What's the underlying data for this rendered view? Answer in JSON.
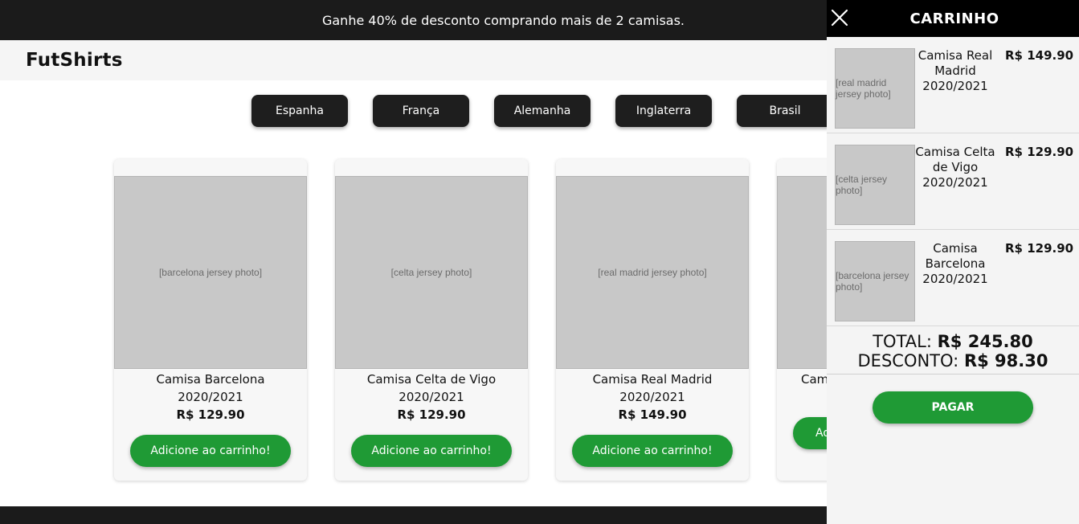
{
  "promo": {
    "text": "Ganhe 40% de desconto comprando mais de 2 camisas."
  },
  "header": {
    "brand": "FutShirts"
  },
  "filters": [
    {
      "label": "Espanha"
    },
    {
      "label": "França"
    },
    {
      "label": "Alemanha"
    },
    {
      "label": "Inglaterra"
    },
    {
      "label": "Brasil"
    }
  ],
  "products": [
    {
      "name": "Camisa Barcelona 2020/2021",
      "price": "R$ 129.90",
      "button": "Adicione ao carrinho!",
      "image": "barcelona-jersey-photo"
    },
    {
      "name": "Camisa Celta de Vigo 2020/2021",
      "price": "R$ 129.90",
      "button": "Adicione ao carrinho!",
      "image": "celta-jersey-photo"
    },
    {
      "name": "Camisa Real Madrid 2020/2021",
      "price": "R$ 149.90",
      "button": "Adicione ao carrinho!",
      "image": "real-madrid-jersey-photo"
    },
    {
      "name": "Camis",
      "price": "",
      "button": "Ad",
      "image": "red-jersey-photo"
    }
  ],
  "cart": {
    "title": "CARRINHO",
    "items": [
      {
        "name": "Camisa Real Madrid 2020/2021",
        "price": "R$ 149.90",
        "image": "real-madrid-jersey-photo"
      },
      {
        "name": "Camisa Celta de Vigo 2020/2021",
        "price": "R$ 129.90",
        "image": "celta-jersey-photo"
      },
      {
        "name": "Camisa Barcelona 2020/2021",
        "price": "R$ 129.90",
        "image": "barcelona-jersey-photo"
      }
    ],
    "total_label": "TOTAL:",
    "total_value": "R$ 245.80",
    "discount_label": "DESCONTO:",
    "discount_value": "R$ 98.30",
    "pay_button": "PAGAR"
  },
  "colors": {
    "accent_green": "#1f9a35",
    "dark": "#1b1b1b"
  }
}
